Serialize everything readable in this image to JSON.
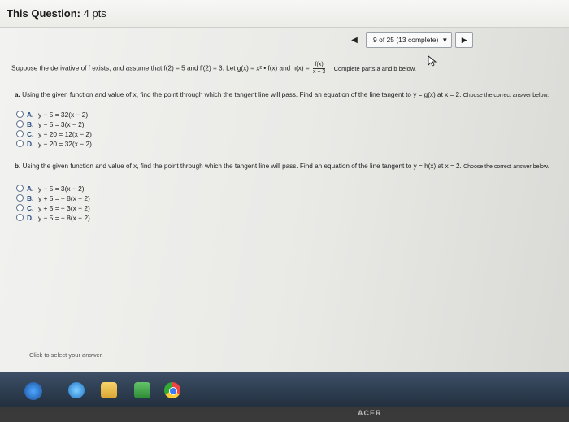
{
  "header": {
    "title": "This Question:",
    "points": "4 pts"
  },
  "nav": {
    "prev_icon": "◀",
    "progress": "9 of 25 (13 complete)",
    "dropdown_icon": "▼",
    "next_icon": "▶"
  },
  "stem": {
    "text": "Suppose the derivative of f exists, and assume that f(2) = 5 and f′(2) = 3. Let g(x) = x² • f(x) and h(x) =",
    "frac_num": "f(x)",
    "frac_den": "x − 3",
    "after": "Complete parts a and b below."
  },
  "part_a": {
    "letter": "a.",
    "text": "Using the given function and value of x, find the point through which the tangent line will pass. Find an equation of the line tangent to y = g(x) at x = 2.",
    "tail": "Choose the correct answer below.",
    "choices": [
      {
        "label": "A.",
        "text": "y − 5 = 32(x − 2)"
      },
      {
        "label": "B.",
        "text": "y − 5 = 3(x − 2)"
      },
      {
        "label": "C.",
        "text": "y − 20 = 12(x − 2)"
      },
      {
        "label": "D.",
        "text": "y − 20 = 32(x − 2)"
      }
    ]
  },
  "part_b": {
    "letter": "b.",
    "text": "Using the given function and value of x, find the point through which the tangent line will pass. Find an equation of the line tangent to y = h(x) at x = 2.",
    "tail": "Choose the correct answer below.",
    "choices": [
      {
        "label": "A.",
        "text": "y − 5 = 3(x − 2)"
      },
      {
        "label": "B.",
        "text": "y + 5 = − 8(x − 2)"
      },
      {
        "label": "C.",
        "text": "y + 5 = − 3(x − 2)"
      },
      {
        "label": "D.",
        "text": "y − 5 = − 8(x − 2)"
      }
    ]
  },
  "footer": {
    "text": "Click to select your answer."
  },
  "taskbar": {
    "icons": [
      "windows-start-icon",
      "internet-explorer-icon",
      "folder-icon",
      "media-player-icon",
      "chrome-icon"
    ]
  },
  "monitor": {
    "brand": "ACER"
  }
}
